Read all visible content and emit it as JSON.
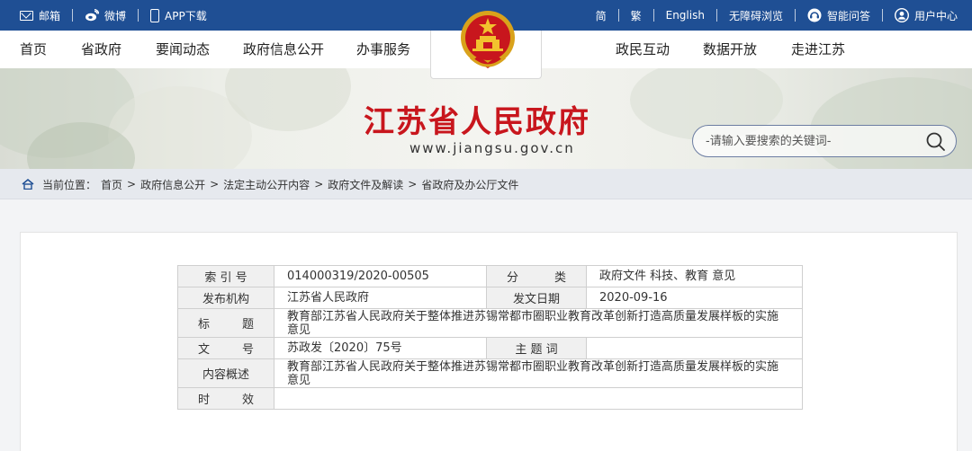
{
  "topbar": {
    "left": [
      {
        "label": "邮箱",
        "icon": "mail-icon"
      },
      {
        "label": "微博",
        "icon": "weibo-icon"
      },
      {
        "label": "APP下载",
        "icon": "phone-icon"
      }
    ],
    "right": [
      {
        "label": "简"
      },
      {
        "label": "繁"
      },
      {
        "label": "English"
      },
      {
        "label": "无障碍浏览"
      },
      {
        "label": "智能问答",
        "icon": "chat-robot-icon"
      },
      {
        "label": "用户中心",
        "icon": "user-icon"
      }
    ]
  },
  "nav": {
    "items": [
      "首页",
      "省政府",
      "要闻动态",
      "政府信息公开",
      "办事服务",
      "政民互动",
      "数据开放",
      "走进江苏"
    ]
  },
  "banner": {
    "title": "江苏省人民政府",
    "url": "www.jiangsu.gov.cn"
  },
  "search": {
    "placeholder": "-请输入要搜索的关键词-"
  },
  "breadcrumb": {
    "prefix": "当前位置：",
    "items": [
      "首页",
      "政府信息公开",
      "法定主动公开内容",
      "政府文件及解读",
      "省政府及办公厅文件"
    ],
    "separator": ">"
  },
  "meta": {
    "index_label": "索 引 号",
    "index_value": "014000319/2020-00505",
    "category_label": "分类",
    "category_value": "政府文件 科技、教育 意见",
    "publisher_label": "发布机构",
    "publisher_value": "江苏省人民政府",
    "date_label": "发文日期",
    "date_value": "2020-09-16",
    "title_label": "标题",
    "title_value": "教育部江苏省人民政府关于整体推进苏锡常都市圈职业教育改革创新打造高质量发展样板的实施意见",
    "docno_label": "文号",
    "docno_value": "苏政发〔2020〕75号",
    "subject_label": "主 题 词",
    "subject_value": "",
    "summary_label": "内容概述",
    "summary_value": "教育部江苏省人民政府关于整体推进苏锡常都市圈职业教育改革创新打造高质量发展样板的实施意见",
    "validity_label": "时效",
    "validity_value": ""
  },
  "colors": {
    "topbar": "#1f4f94",
    "title_red": "#c8161d"
  }
}
